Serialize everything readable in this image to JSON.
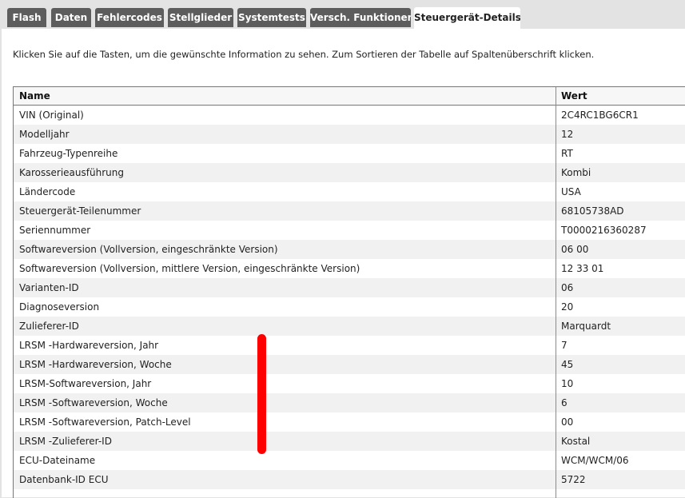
{
  "tabs": [
    {
      "label": "Flash",
      "active": false
    },
    {
      "label": "Daten",
      "active": false
    },
    {
      "label": "Fehlercodes",
      "active": false
    },
    {
      "label": "Stellglieder",
      "active": false
    },
    {
      "label": "Systemtests",
      "active": false
    },
    {
      "label": "Versch. Funktionen",
      "active": false
    },
    {
      "label": "Steuergerät-Details",
      "active": true
    }
  ],
  "instruction": "Klicken Sie auf die Tasten, um die gewünschte Information zu sehen.  Zum Sortieren der Tabelle auf Spaltenüberschrift klicken.",
  "table": {
    "columns": [
      "Name",
      "Wert"
    ],
    "rows": [
      {
        "name": "VIN (Original)",
        "value": "2C4RC1BG6CR1"
      },
      {
        "name": "Modelljahr",
        "value": "12"
      },
      {
        "name": "Fahrzeug-Typenreihe",
        "value": "RT"
      },
      {
        "name": "Karosserieausführung",
        "value": "Kombi"
      },
      {
        "name": "Ländercode",
        "value": "USA"
      },
      {
        "name": "Steuergerät-Teilenummer",
        "value": "68105738AD"
      },
      {
        "name": "Seriennummer",
        "value": "T0000216360287"
      },
      {
        "name": "Softwareversion (Vollversion, eingeschränkte Version)",
        "value": "06 00"
      },
      {
        "name": "Softwareversion (Vollversion, mittlere Version, eingeschränkte Version)",
        "value": "12 33 01"
      },
      {
        "name": "Varianten-ID",
        "value": "06"
      },
      {
        "name": "Diagnoseversion",
        "value": "20"
      },
      {
        "name": "Zulieferer-ID",
        "value": "Marquardt"
      },
      {
        "name": "LRSM -Hardwareversion, Jahr",
        "value": "7"
      },
      {
        "name": "LRSM -Hardwareversion, Woche",
        "value": "45"
      },
      {
        "name": "LRSM-Softwareversion, Jahr",
        "value": "10"
      },
      {
        "name": "LRSM -Softwareversion, Woche",
        "value": "6"
      },
      {
        "name": "LRSM -Softwareversion, Patch-Level",
        "value": "00"
      },
      {
        "name": "LRSM -Zulieferer-ID",
        "value": "Kostal"
      },
      {
        "name": "ECU-Dateiname",
        "value": "WCM/WCM/06"
      },
      {
        "name": "Datenbank-ID ECU",
        "value": "5722"
      }
    ]
  },
  "colors": {
    "tab_inactive": "#5d5d5d",
    "tab_active": "#ffffff",
    "annotation_marker": "#ff0000",
    "row_alt": "#f1f1f1"
  }
}
